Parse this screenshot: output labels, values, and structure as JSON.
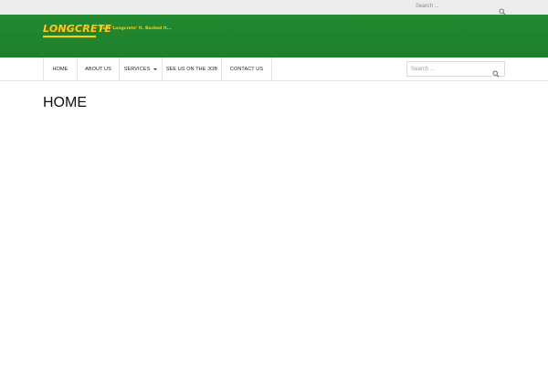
{
  "top_bar": {
    "search_placeholder": "Search ...",
    "search_icon": "search-icon"
  },
  "header": {
    "logo_text": "LONGCRETE",
    "logo_tagline": "Bust 'Longcrete' It. Backed It...",
    "brand_color": "#228a30",
    "logo_color": "#f2d11a"
  },
  "nav": {
    "items": [
      {
        "label": "HOME"
      },
      {
        "label": "ABOUT US"
      },
      {
        "label": "SERVICES",
        "has_dropdown": true
      },
      {
        "label": "SEE US ON THE JOB"
      },
      {
        "label": "CONTACT US"
      }
    ],
    "search_placeholder": "Search ...",
    "search_icon": "search-icon"
  },
  "main": {
    "title": "HOME"
  }
}
